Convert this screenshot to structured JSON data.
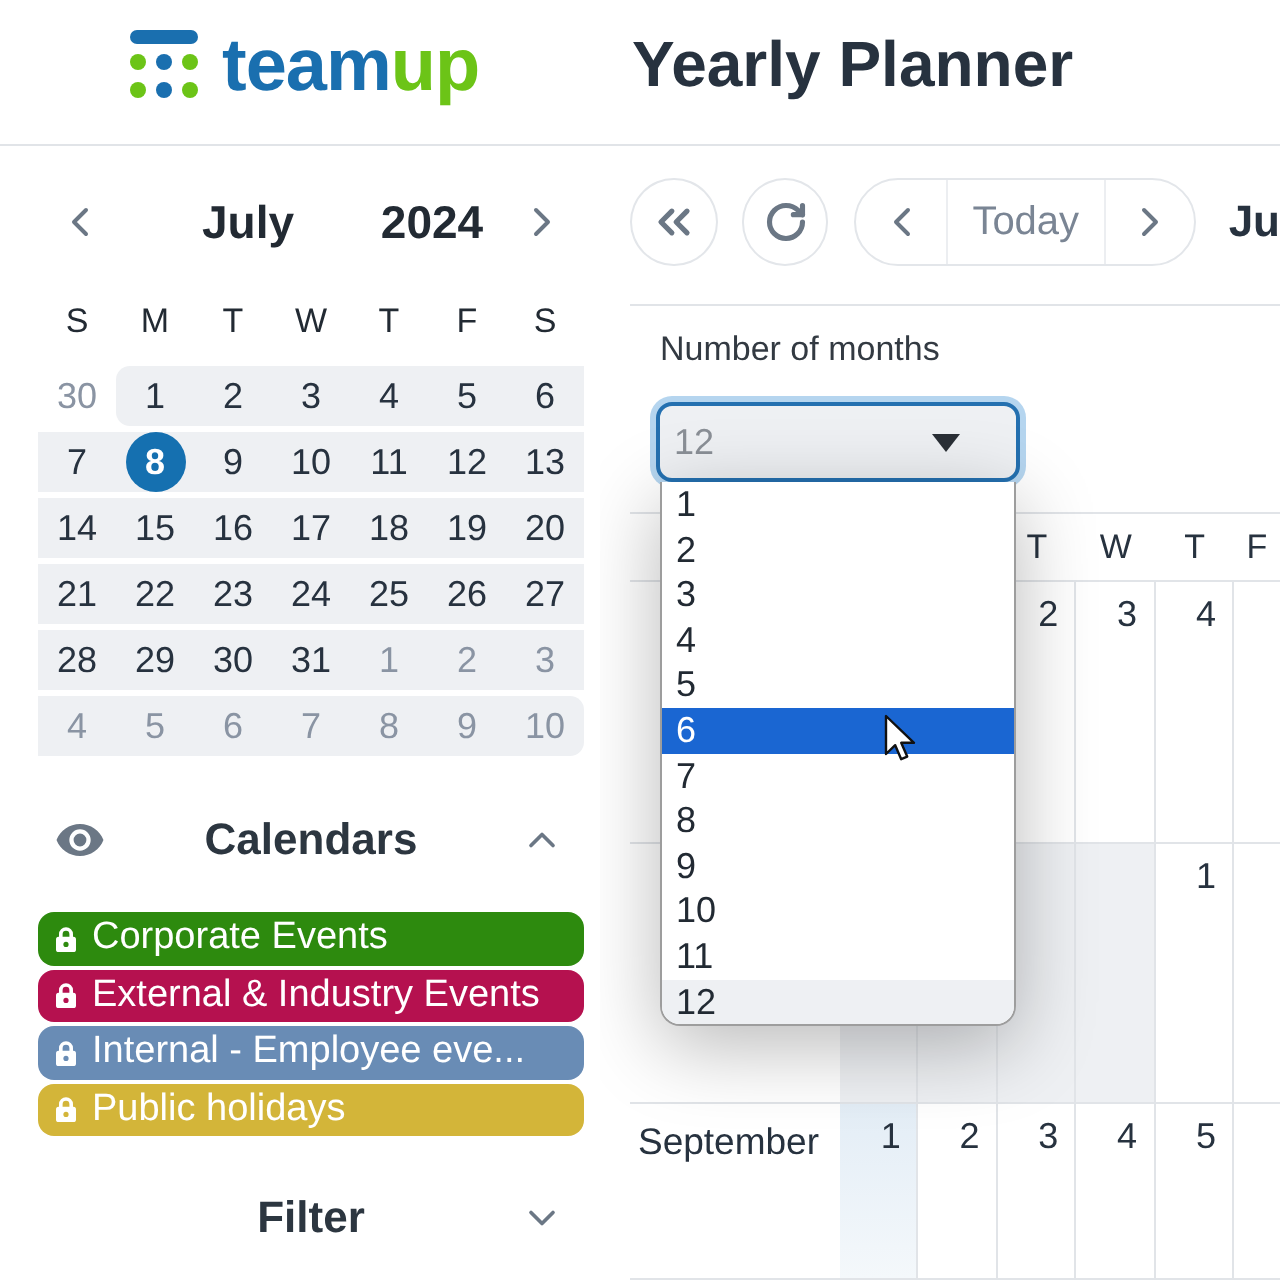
{
  "header": {
    "logo": [
      "team",
      "up"
    ],
    "title": "Yearly Planner"
  },
  "mini_calendar": {
    "month": "July",
    "year": "2024",
    "weekdays": [
      "S",
      "M",
      "T",
      "W",
      "T",
      "F",
      "S"
    ],
    "weeks": [
      [
        {
          "day": "30",
          "outside": true,
          "in_range": false,
          "today": false
        },
        {
          "day": "1",
          "outside": false,
          "in_range": true,
          "today": false
        },
        {
          "day": "2",
          "outside": false,
          "in_range": true,
          "today": false
        },
        {
          "day": "3",
          "outside": false,
          "in_range": true,
          "today": false
        },
        {
          "day": "4",
          "outside": false,
          "in_range": true,
          "today": false
        },
        {
          "day": "5",
          "outside": false,
          "in_range": true,
          "today": false
        },
        {
          "day": "6",
          "outside": false,
          "in_range": true,
          "today": false
        }
      ],
      [
        {
          "day": "7",
          "outside": false,
          "in_range": true,
          "today": false
        },
        {
          "day": "8",
          "outside": false,
          "in_range": true,
          "today": true
        },
        {
          "day": "9",
          "outside": false,
          "in_range": true,
          "today": false
        },
        {
          "day": "10",
          "outside": false,
          "in_range": true,
          "today": false
        },
        {
          "day": "11",
          "outside": false,
          "in_range": true,
          "today": false
        },
        {
          "day": "12",
          "outside": false,
          "in_range": true,
          "today": false
        },
        {
          "day": "13",
          "outside": false,
          "in_range": true,
          "today": false
        }
      ],
      [
        {
          "day": "14",
          "outside": false,
          "in_range": true,
          "today": false
        },
        {
          "day": "15",
          "outside": false,
          "in_range": true,
          "today": false
        },
        {
          "day": "16",
          "outside": false,
          "in_range": true,
          "today": false
        },
        {
          "day": "17",
          "outside": false,
          "in_range": true,
          "today": false
        },
        {
          "day": "18",
          "outside": false,
          "in_range": true,
          "today": false
        },
        {
          "day": "19",
          "outside": false,
          "in_range": true,
          "today": false
        },
        {
          "day": "20",
          "outside": false,
          "in_range": true,
          "today": false
        }
      ],
      [
        {
          "day": "21",
          "outside": false,
          "in_range": true,
          "today": false
        },
        {
          "day": "22",
          "outside": false,
          "in_range": true,
          "today": false
        },
        {
          "day": "23",
          "outside": false,
          "in_range": true,
          "today": false
        },
        {
          "day": "24",
          "outside": false,
          "in_range": true,
          "today": false
        },
        {
          "day": "25",
          "outside": false,
          "in_range": true,
          "today": false
        },
        {
          "day": "26",
          "outside": false,
          "in_range": true,
          "today": false
        },
        {
          "day": "27",
          "outside": false,
          "in_range": true,
          "today": false
        }
      ],
      [
        {
          "day": "28",
          "outside": false,
          "in_range": true,
          "today": false
        },
        {
          "day": "29",
          "outside": false,
          "in_range": true,
          "today": false
        },
        {
          "day": "30",
          "outside": false,
          "in_range": true,
          "today": false
        },
        {
          "day": "31",
          "outside": false,
          "in_range": true,
          "today": false
        },
        {
          "day": "1",
          "outside": true,
          "in_range": true,
          "today": false
        },
        {
          "day": "2",
          "outside": true,
          "in_range": true,
          "today": false
        },
        {
          "day": "3",
          "outside": true,
          "in_range": true,
          "today": false
        }
      ],
      [
        {
          "day": "4",
          "outside": true,
          "in_range": true,
          "today": false
        },
        {
          "day": "5",
          "outside": true,
          "in_range": true,
          "today": false
        },
        {
          "day": "6",
          "outside": true,
          "in_range": true,
          "today": false
        },
        {
          "day": "7",
          "outside": true,
          "in_range": true,
          "today": false
        },
        {
          "day": "8",
          "outside": true,
          "in_range": true,
          "today": false
        },
        {
          "day": "9",
          "outside": true,
          "in_range": true,
          "today": false
        },
        {
          "day": "10",
          "outside": true,
          "in_range": true,
          "today": false
        }
      ]
    ]
  },
  "calendars": {
    "title": "Calendars",
    "expanded": true,
    "items": [
      {
        "name": "Corporate Events",
        "color": "#2d8a0e",
        "locked": true
      },
      {
        "name": "External & Industry Events",
        "color": "#b5114f",
        "locked": true
      },
      {
        "name": "Internal - Employee eve...",
        "color": "#698cb5",
        "locked": true
      },
      {
        "name": "Public holidays",
        "color": "#d3b539",
        "locked": true
      }
    ]
  },
  "filter": {
    "title": "Filter",
    "expanded": false
  },
  "toolbar": {
    "today": "Today",
    "range_title": "Ju"
  },
  "months_select": {
    "label": "Number of months",
    "value": "12",
    "open": true,
    "options": [
      {
        "label": "1",
        "highlighted": false,
        "selected": false
      },
      {
        "label": "2",
        "highlighted": false,
        "selected": false
      },
      {
        "label": "3",
        "highlighted": false,
        "selected": false
      },
      {
        "label": "4",
        "highlighted": false,
        "selected": false
      },
      {
        "label": "5",
        "highlighted": false,
        "selected": false
      },
      {
        "label": "6",
        "highlighted": true,
        "selected": false
      },
      {
        "label": "7",
        "highlighted": false,
        "selected": false
      },
      {
        "label": "8",
        "highlighted": false,
        "selected": false
      },
      {
        "label": "9",
        "highlighted": false,
        "selected": false
      },
      {
        "label": "10",
        "highlighted": false,
        "selected": false
      },
      {
        "label": "11",
        "highlighted": false,
        "selected": false
      },
      {
        "label": "12",
        "highlighted": false,
        "selected": true
      }
    ]
  },
  "planner": {
    "weekdays": [
      "T",
      "W",
      "T",
      "F"
    ],
    "months": [
      {
        "cells": [
          {
            "kind": "day",
            "day": "2"
          },
          {
            "kind": "day",
            "day": "3"
          },
          {
            "kind": "day",
            "day": "4"
          },
          {
            "kind": "day"
          }
        ]
      },
      {
        "cells": [
          {
            "kind": "blank"
          },
          {
            "kind": "blank"
          },
          {
            "kind": "blank"
          },
          {
            "kind": "blank"
          },
          {
            "kind": "day",
            "day": "1"
          },
          {
            "kind": "day"
          }
        ]
      },
      {
        "name": "September",
        "cells": [
          {
            "kind": "weekend",
            "day": "1"
          },
          {
            "kind": "day",
            "day": "2"
          },
          {
            "kind": "day",
            "day": "3"
          },
          {
            "kind": "day",
            "day": "4"
          },
          {
            "kind": "day",
            "day": "5"
          },
          {
            "kind": "day"
          }
        ]
      }
    ]
  }
}
